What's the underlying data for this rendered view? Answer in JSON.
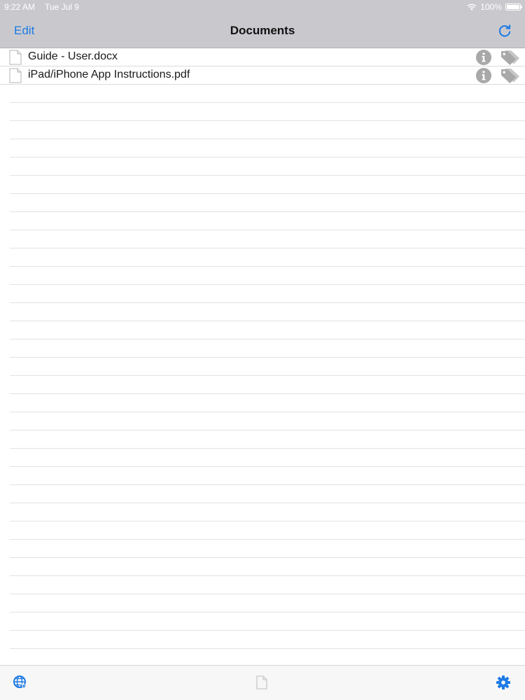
{
  "status_bar": {
    "time": "9:22 AM",
    "date": "Tue Jul 9",
    "battery_text": "100%",
    "battery_level": 1.0
  },
  "nav_bar": {
    "edit_label": "Edit",
    "title": "Documents",
    "refresh_icon": "refresh-icon"
  },
  "documents": [
    {
      "name": "Guide - User.docx",
      "icon": "document-icon"
    },
    {
      "name": "iPad/iPhone App Instructions.pdf",
      "icon": "document-icon"
    }
  ],
  "toolbar": {
    "left_icon": "globe-icon",
    "center_icon": "new-document-icon",
    "right_icon": "gear-icon"
  },
  "colors": {
    "accent": "#1e7ae6",
    "bar_background": "#c9c9cd",
    "row_icon_gray": "#a8a8a8"
  }
}
